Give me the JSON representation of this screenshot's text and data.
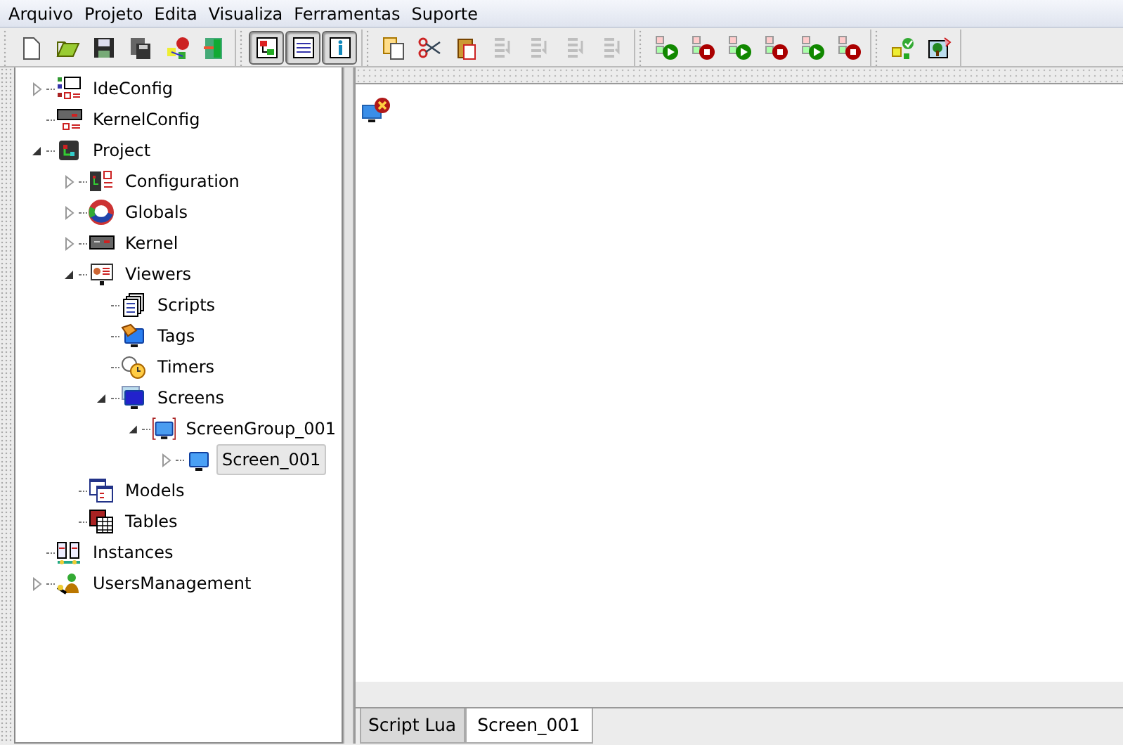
{
  "menu": [
    {
      "label": "Arquivo"
    },
    {
      "label": "Projeto"
    },
    {
      "label": "Edita"
    },
    {
      "label": "Visualiza"
    },
    {
      "label": "Ferramentas"
    },
    {
      "label": "Suporte"
    }
  ],
  "toolbar": [
    {
      "buttons": [
        {
          "kind": "new",
          "pressed": false,
          "disabled": false
        },
        {
          "kind": "open",
          "pressed": false,
          "disabled": false
        },
        {
          "kind": "save",
          "pressed": false,
          "disabled": false
        },
        {
          "kind": "save-all",
          "pressed": false,
          "disabled": false
        },
        {
          "kind": "wizard",
          "pressed": false,
          "disabled": false
        },
        {
          "kind": "exit",
          "pressed": false,
          "disabled": false
        }
      ]
    },
    {
      "buttons": [
        {
          "kind": "tree",
          "pressed": true,
          "disabled": false
        },
        {
          "kind": "list",
          "pressed": true,
          "disabled": false
        },
        {
          "kind": "info",
          "pressed": true,
          "disabled": false
        }
      ]
    },
    {
      "buttons": [
        {
          "kind": "copy",
          "pressed": false,
          "disabled": false
        },
        {
          "kind": "cut",
          "pressed": false,
          "disabled": false
        },
        {
          "kind": "paste",
          "pressed": false,
          "disabled": false
        },
        {
          "kind": "align",
          "pressed": false,
          "disabled": true
        },
        {
          "kind": "align",
          "pressed": false,
          "disabled": true
        },
        {
          "kind": "align",
          "pressed": false,
          "disabled": true
        },
        {
          "kind": "align",
          "pressed": false,
          "disabled": true
        }
      ]
    },
    {
      "buttons": [
        {
          "kind": "run",
          "pressed": false,
          "disabled": false
        },
        {
          "kind": "stop",
          "pressed": false,
          "disabled": false
        },
        {
          "kind": "run",
          "pressed": false,
          "disabled": false
        },
        {
          "kind": "stop",
          "pressed": false,
          "disabled": false
        },
        {
          "kind": "run",
          "pressed": false,
          "disabled": false
        },
        {
          "kind": "stop",
          "pressed": false,
          "disabled": false
        }
      ]
    },
    {
      "buttons": [
        {
          "kind": "check",
          "pressed": false,
          "disabled": false
        },
        {
          "kind": "picture",
          "pressed": false,
          "disabled": false
        }
      ]
    }
  ],
  "tree": [
    {
      "label": "IdeConfig",
      "kind": "config",
      "expanded": false,
      "selected": false
    },
    {
      "label": "KernelConfig",
      "kind": "kernel-config",
      "selected": false
    },
    {
      "label": "Project",
      "kind": "project",
      "expanded": true,
      "selected": false,
      "children": [
        {
          "label": "Configuration",
          "kind": "configuration",
          "expanded": false,
          "selected": false
        },
        {
          "label": "Globals",
          "kind": "globals",
          "expanded": false,
          "selected": false
        },
        {
          "label": "Kernel",
          "kind": "kernel",
          "expanded": false,
          "selected": false
        },
        {
          "label": "Viewers",
          "kind": "viewers",
          "expanded": true,
          "selected": false,
          "children": [
            {
              "label": "Scripts",
              "kind": "scripts",
              "selected": false
            },
            {
              "label": "Tags",
              "kind": "tags",
              "selected": false
            },
            {
              "label": "Timers",
              "kind": "timers",
              "selected": false
            },
            {
              "label": "Screens",
              "kind": "screens",
              "expanded": true,
              "selected": false,
              "children": [
                {
                  "label": "ScreenGroup_001",
                  "kind": "screen-group",
                  "expanded": true,
                  "selected": false,
                  "children": [
                    {
                      "label": "Screen_001",
                      "kind": "screen",
                      "expanded": false,
                      "selected": true
                    }
                  ]
                }
              ]
            }
          ]
        },
        {
          "label": "Models",
          "kind": "models",
          "selected": false
        },
        {
          "label": "Tables",
          "kind": "tables",
          "selected": false
        }
      ]
    },
    {
      "label": "Instances",
      "kind": "instances",
      "selected": false
    },
    {
      "label": "UsersManagement",
      "kind": "users",
      "expanded": false,
      "selected": false
    }
  ],
  "tabs": [
    {
      "label": "Script Lua",
      "selected": false
    },
    {
      "label": "Screen_001",
      "selected": true
    }
  ]
}
